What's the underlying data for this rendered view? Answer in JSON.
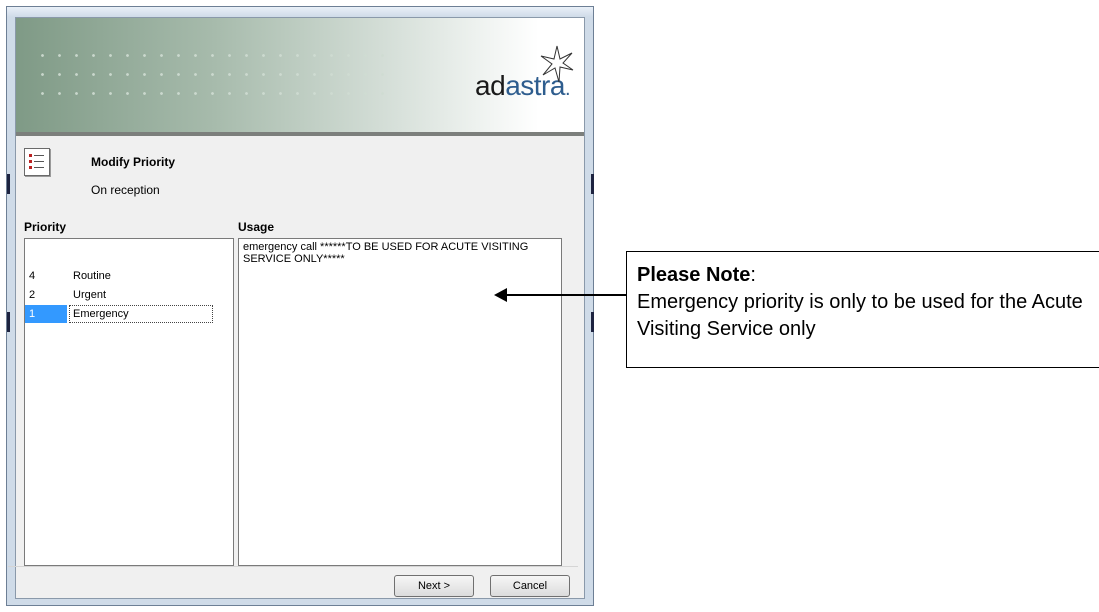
{
  "banner": {
    "logo_part1": "ad",
    "logo_part2": "astra",
    "logo_dot": "."
  },
  "task": {
    "title": "Modify Priority",
    "subtitle": "On reception"
  },
  "priority": {
    "label": "Priority",
    "items": [
      {
        "num": "4",
        "name": "Routine"
      },
      {
        "num": "2",
        "name": "Urgent"
      },
      {
        "num": "1",
        "name": "Emergency",
        "selected": true
      }
    ]
  },
  "usage": {
    "label": "Usage",
    "text": "emergency call ******TO BE USED FOR ACUTE VISITING SERVICE ONLY*****"
  },
  "buttons": {
    "next_label": "Next >",
    "cancel_label": "Cancel"
  },
  "callout": {
    "heading": "Please Note",
    "colon": ":",
    "body": "Emergency priority is only to be used for the Acute Visiting Service only"
  },
  "colors": {
    "selection": "#3399ff",
    "logo_accent": "#2e5d8e"
  }
}
